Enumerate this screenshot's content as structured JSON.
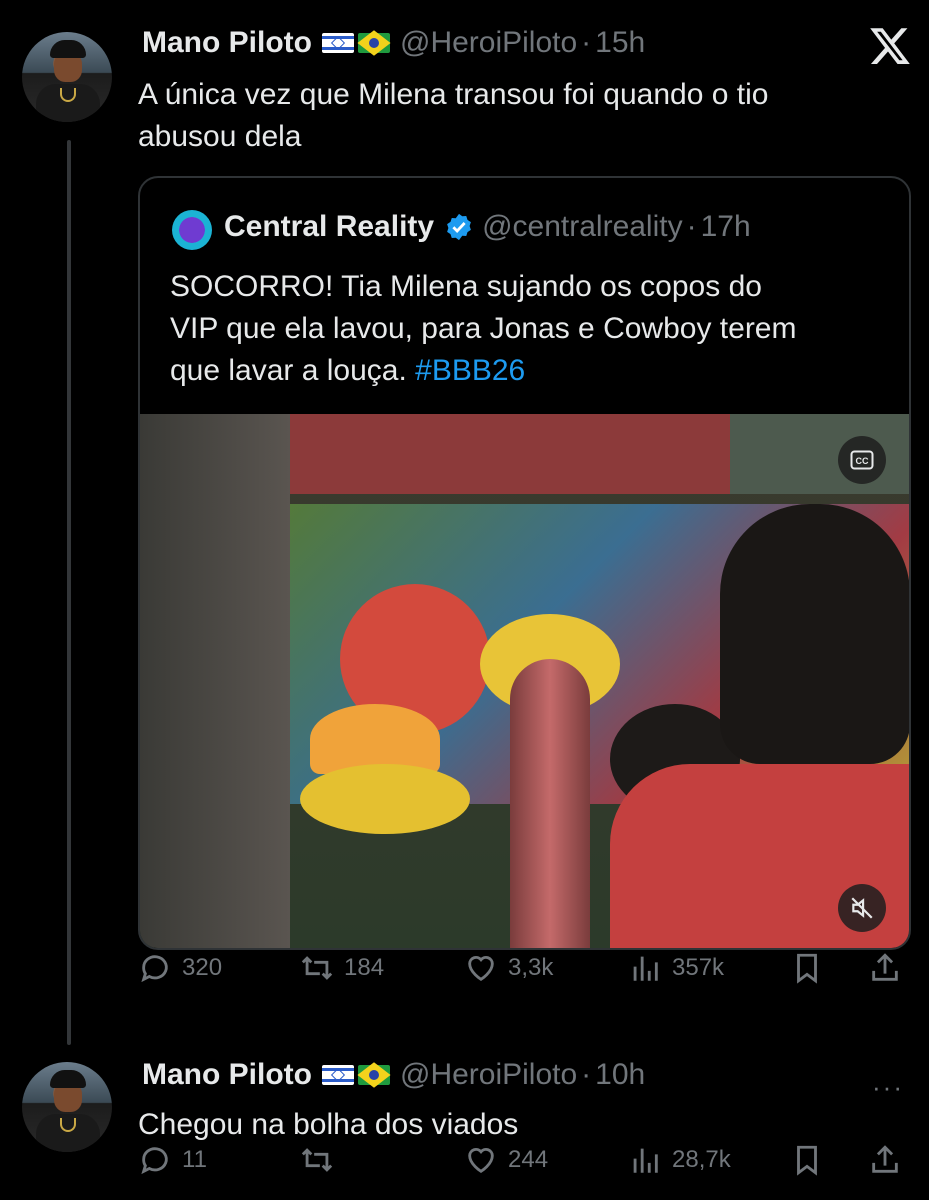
{
  "post": {
    "name": "Mano Piloto",
    "handle": "@HeroiPiloto",
    "separator": "·",
    "time": "15h",
    "text_line1": "A única vez que Milena transou foi quando o tio",
    "text_line2": "abusou dela"
  },
  "quoted": {
    "name": "Central Reality",
    "handle": "@centralreality",
    "separator": "·",
    "time": "17h",
    "text_line1": "SOCORRO! Tia Milena sujando os copos do",
    "text_line2": "VIP que ela lavou, para Jonas e Cowboy terem",
    "text_line3_prefix": "que lavar a louça. ",
    "hashtag": "#BBB26",
    "video_cc_label": "CC"
  },
  "post_metrics": {
    "replies": "320",
    "reposts": "184",
    "likes": "3,3k",
    "views": "357k"
  },
  "reply": {
    "name": "Mano Piloto",
    "handle": "@HeroiPiloto",
    "separator": "·",
    "time": "10h",
    "text": "Chegou na bolha dos viados",
    "more": "···"
  },
  "reply_metrics": {
    "replies": "11",
    "reposts": "",
    "likes": "244",
    "views": "28,7k"
  },
  "icons": [
    "x-logo-icon",
    "verified-icon",
    "reply-icon",
    "repost-icon",
    "like-icon",
    "views-icon",
    "bookmark-icon",
    "share-icon",
    "cc-icon",
    "mute-icon",
    "more-icon"
  ],
  "colors": {
    "background": "#000000",
    "text": "#e7e9ea",
    "muted": "#71767b",
    "link": "#1d9bf0",
    "border": "#2f3336"
  }
}
